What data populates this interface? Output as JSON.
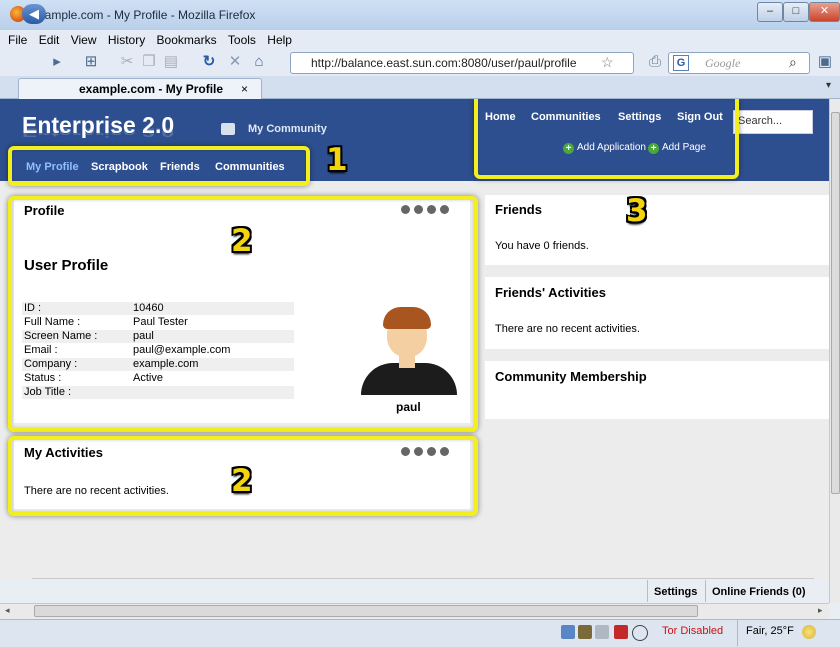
{
  "window": {
    "title": "example.com - My Profile - Mozilla Firefox"
  },
  "menubar": {
    "items": [
      "File",
      "Edit",
      "View",
      "History",
      "Bookmarks",
      "Tools",
      "Help"
    ]
  },
  "toolbar": {
    "url": "http://balance.east.sun.com:8080/user/paul/profile",
    "search_placeholder": "Google",
    "search_engine_letter": "G"
  },
  "tab": {
    "label": "example.com - My Profile",
    "close": "×"
  },
  "site": {
    "brand": "Enterprise 2.0",
    "community_link": "My Community",
    "subnav": [
      "My Profile",
      "Scrapbook",
      "Friends",
      "Communities"
    ],
    "topnav": [
      "Home",
      "Communities",
      "Settings",
      "Sign Out"
    ],
    "search_value": "Search...",
    "add_application": "Add Application",
    "add_page": "Add Page"
  },
  "annotations": [
    "1",
    "2",
    "2",
    "3"
  ],
  "profile_portlet": {
    "title": "Profile",
    "heading": "User Profile",
    "rows": [
      {
        "label": "ID :",
        "value": "10460"
      },
      {
        "label": "Full Name :",
        "value": "Paul Tester"
      },
      {
        "label": "Screen Name :",
        "value": "paul"
      },
      {
        "label": "Email :",
        "value": "paul@example.com"
      },
      {
        "label": "Company :",
        "value": "example.com"
      },
      {
        "label": "Status :",
        "value": "Active"
      },
      {
        "label": "Job Title :",
        "value": ""
      }
    ],
    "avatar_name": "paul"
  },
  "activities_portlet": {
    "title": "My Activities",
    "message": "There are no recent activities."
  },
  "friends_portlet": {
    "title": "Friends",
    "message": "You have 0 friends."
  },
  "friends_activities_portlet": {
    "title": "Friends' Activities",
    "message": "There are no recent activities."
  },
  "community_portlet": {
    "title": "Community Membership"
  },
  "dock": {
    "settings": "Settings",
    "online_friends": "Online Friends (0)"
  },
  "statusbar": {
    "tor": "Tor Disabled",
    "weather": "Fair, 25°F"
  },
  "colors": {
    "banner": "#2e4f8f",
    "highlight": "#f3ef1c",
    "annotation_digit": "#f2d40e"
  }
}
